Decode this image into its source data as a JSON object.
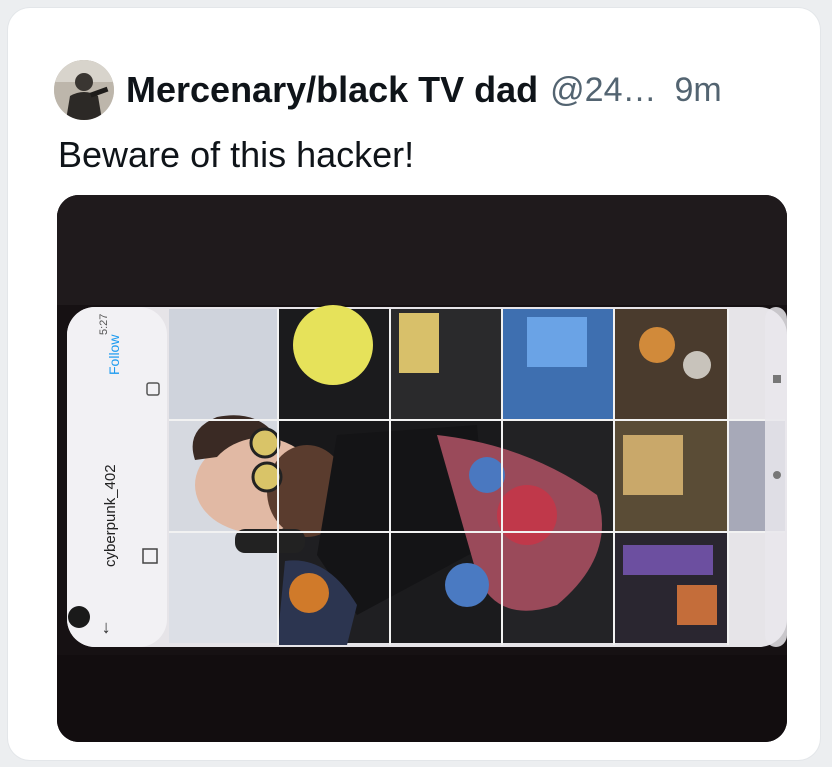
{
  "tweet": {
    "author_name": "Mercenary/black TV dad",
    "author_handle": "@24…",
    "timestamp": "9m",
    "text": "Beware of this hacker!"
  },
  "photo": {
    "description_icon": "photo-of-phone-screen",
    "profile_username": "cyberpunk_402",
    "follow_label": "Follow",
    "status_time": "5:27"
  },
  "colors": {
    "text_primary": "#0f1419",
    "text_secondary": "#536471",
    "follow_blue": "#1d9bf0",
    "card_bg": "#ffffff"
  }
}
